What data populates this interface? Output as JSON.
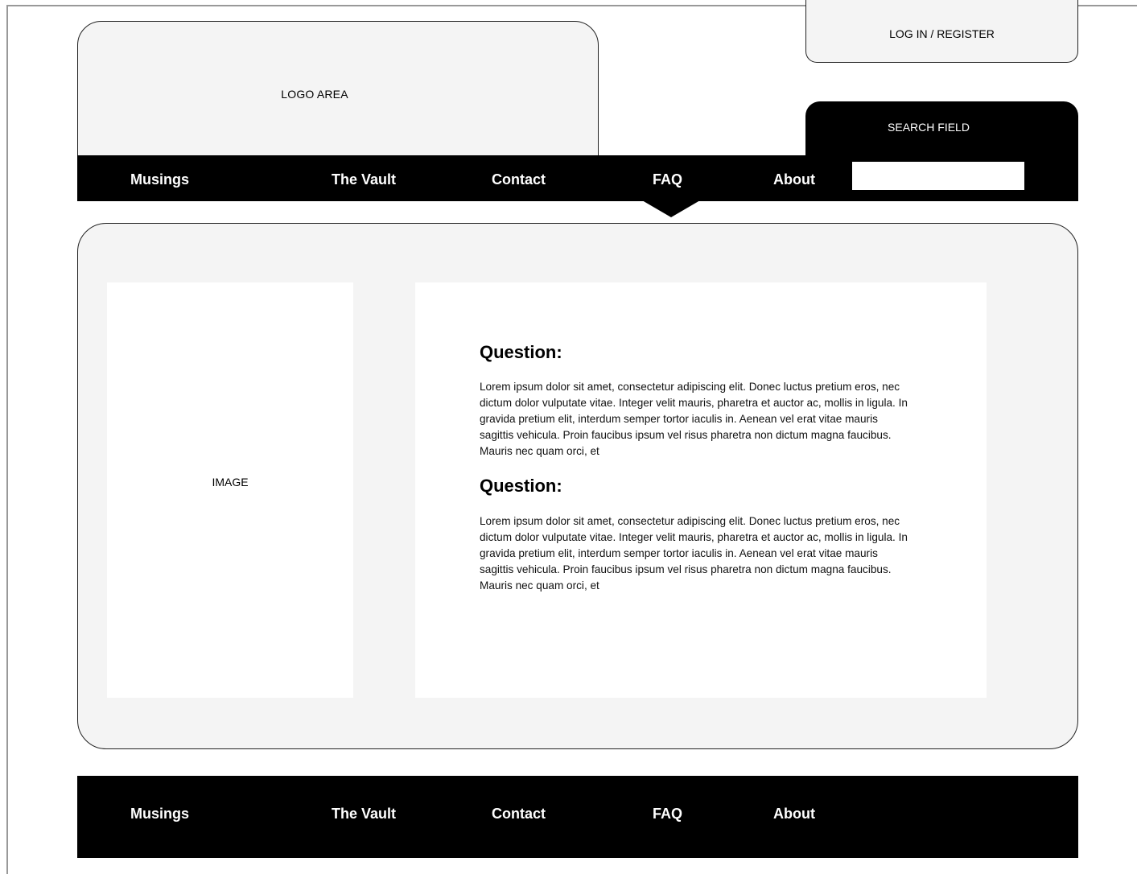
{
  "header": {
    "logo_label": "LOGO AREA",
    "login_label": "LOG IN / REGISTER",
    "search_label": "SEARCH FIELD",
    "search_value": ""
  },
  "nav": {
    "items": [
      {
        "label": "Musings"
      },
      {
        "label": "The Vault"
      },
      {
        "label": "Contact"
      },
      {
        "label": "FAQ"
      },
      {
        "label": "About"
      }
    ],
    "active": "FAQ"
  },
  "main": {
    "image_label": "IMAGE",
    "faq": [
      {
        "question": "Question:",
        "answer": "Lorem ipsum dolor sit amet, consectetur adipiscing elit. Donec luctus pretium eros, nec dictum dolor vulputate vitae. Integer velit mauris, pharetra et auctor ac, mollis in ligula. In gravida pretium elit, interdum semper tortor iaculis in. Aenean vel erat vitae mauris sagittis vehicula. Proin faucibus ipsum vel risus pharetra non dictum magna faucibus. Mauris nec quam orci, et"
      },
      {
        "question": "Question:",
        "answer": "Lorem ipsum dolor sit amet, consectetur adipiscing elit. Donec luctus pretium eros, nec dictum dolor vulputate vitae. Integer velit mauris, pharetra et auctor ac, mollis in ligula. In gravida pretium elit, interdum semper tortor iaculis in. Aenean vel erat vitae mauris sagittis vehicula. Proin faucibus ipsum vel risus pharetra non dictum magna faucibus. Mauris nec quam orci, et"
      }
    ]
  },
  "footer": {
    "items": [
      {
        "label": "Musings"
      },
      {
        "label": "The Vault"
      },
      {
        "label": "Contact"
      },
      {
        "label": "FAQ"
      },
      {
        "label": "About"
      }
    ]
  }
}
